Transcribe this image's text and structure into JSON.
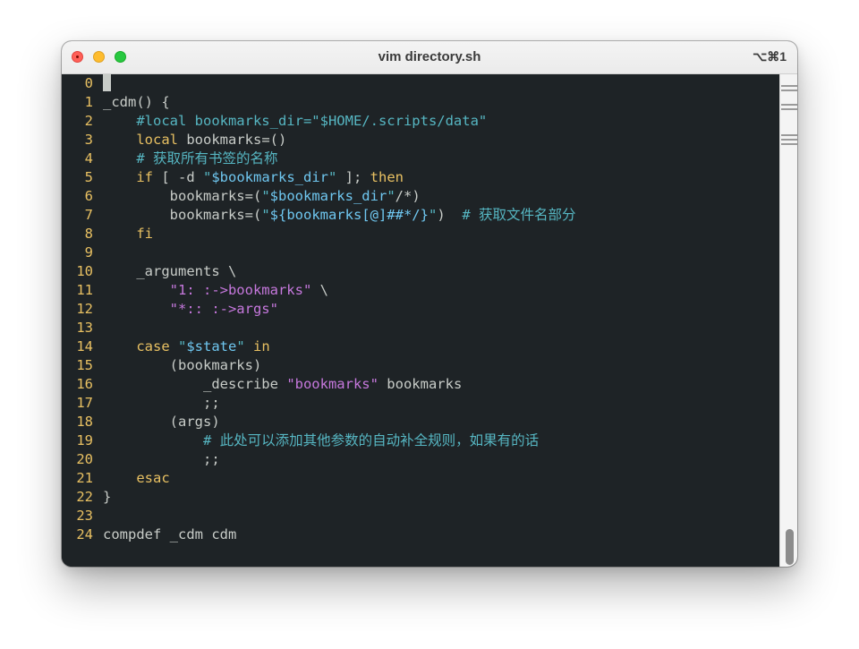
{
  "window": {
    "title": "vim directory.sh",
    "shortcut": "⌥⌘1"
  },
  "colors": {
    "background": "#1e2326",
    "line_number": "#e8c062",
    "comment": "#56b6c2",
    "keyword": "#e8c062",
    "string": "#56b6c2",
    "variable": "#6fc7f0",
    "string_literal": "#c678dd"
  },
  "editor": {
    "cursor_line": 0,
    "lines": [
      {
        "n": "0",
        "text": ""
      },
      {
        "n": "1",
        "text": "_cdm() {"
      },
      {
        "n": "2",
        "text": "    #local bookmarks_dir=\"$HOME/.scripts/data\""
      },
      {
        "n": "3",
        "text": "    local bookmarks=()"
      },
      {
        "n": "4",
        "text": "    # 获取所有书签的名称"
      },
      {
        "n": "5",
        "text": "    if [ -d \"$bookmarks_dir\" ]; then"
      },
      {
        "n": "6",
        "text": "        bookmarks=(\"$bookmarks_dir\"/*)"
      },
      {
        "n": "7",
        "text": "        bookmarks=(\"${bookmarks[@]##*/}\")  # 获取文件名部分"
      },
      {
        "n": "8",
        "text": "    fi"
      },
      {
        "n": "9",
        "text": ""
      },
      {
        "n": "10",
        "text": "    _arguments \\"
      },
      {
        "n": "11",
        "text": "        \"1: :->bookmarks\" \\"
      },
      {
        "n": "12",
        "text": "        \"*:: :->args\""
      },
      {
        "n": "13",
        "text": ""
      },
      {
        "n": "14",
        "text": "    case \"$state\" in"
      },
      {
        "n": "15",
        "text": "        (bookmarks)"
      },
      {
        "n": "16",
        "text": "            _describe \"bookmarks\" bookmarks"
      },
      {
        "n": "17",
        "text": "            ;;"
      },
      {
        "n": "18",
        "text": "        (args)"
      },
      {
        "n": "19",
        "text": "            # 此处可以添加其他参数的自动补全规则，如果有的话"
      },
      {
        "n": "20",
        "text": "            ;;"
      },
      {
        "n": "21",
        "text": "    esac"
      },
      {
        "n": "22",
        "text": "}"
      },
      {
        "n": "23",
        "text": ""
      },
      {
        "n": "24",
        "text": "compdef _cdm cdm"
      }
    ]
  }
}
